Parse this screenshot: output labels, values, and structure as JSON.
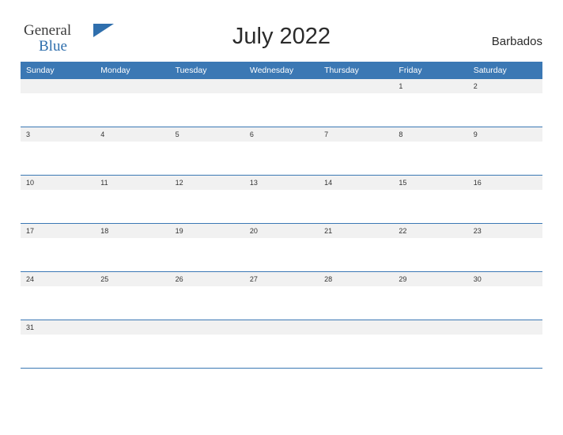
{
  "logo": {
    "word_general": "General",
    "word_blue": "Blue"
  },
  "header": {
    "title": "July 2022",
    "region": "Barbados"
  },
  "calendar": {
    "weekday_headers": [
      "Sunday",
      "Monday",
      "Tuesday",
      "Wednesday",
      "Thursday",
      "Friday",
      "Saturday"
    ],
    "weeks": [
      [
        "",
        "",
        "",
        "",
        "",
        "1",
        "2"
      ],
      [
        "3",
        "4",
        "5",
        "6",
        "7",
        "8",
        "9"
      ],
      [
        "10",
        "11",
        "12",
        "13",
        "14",
        "15",
        "16"
      ],
      [
        "17",
        "18",
        "19",
        "20",
        "21",
        "22",
        "23"
      ],
      [
        "24",
        "25",
        "26",
        "27",
        "28",
        "29",
        "30"
      ],
      [
        "31",
        "",
        "",
        "",
        "",
        "",
        ""
      ]
    ]
  },
  "colors": {
    "header_blue": "#3b78b4",
    "band_grey": "#f1f1f1",
    "logo_blue": "#2f6fad",
    "text_dark": "#2b2b2b"
  }
}
